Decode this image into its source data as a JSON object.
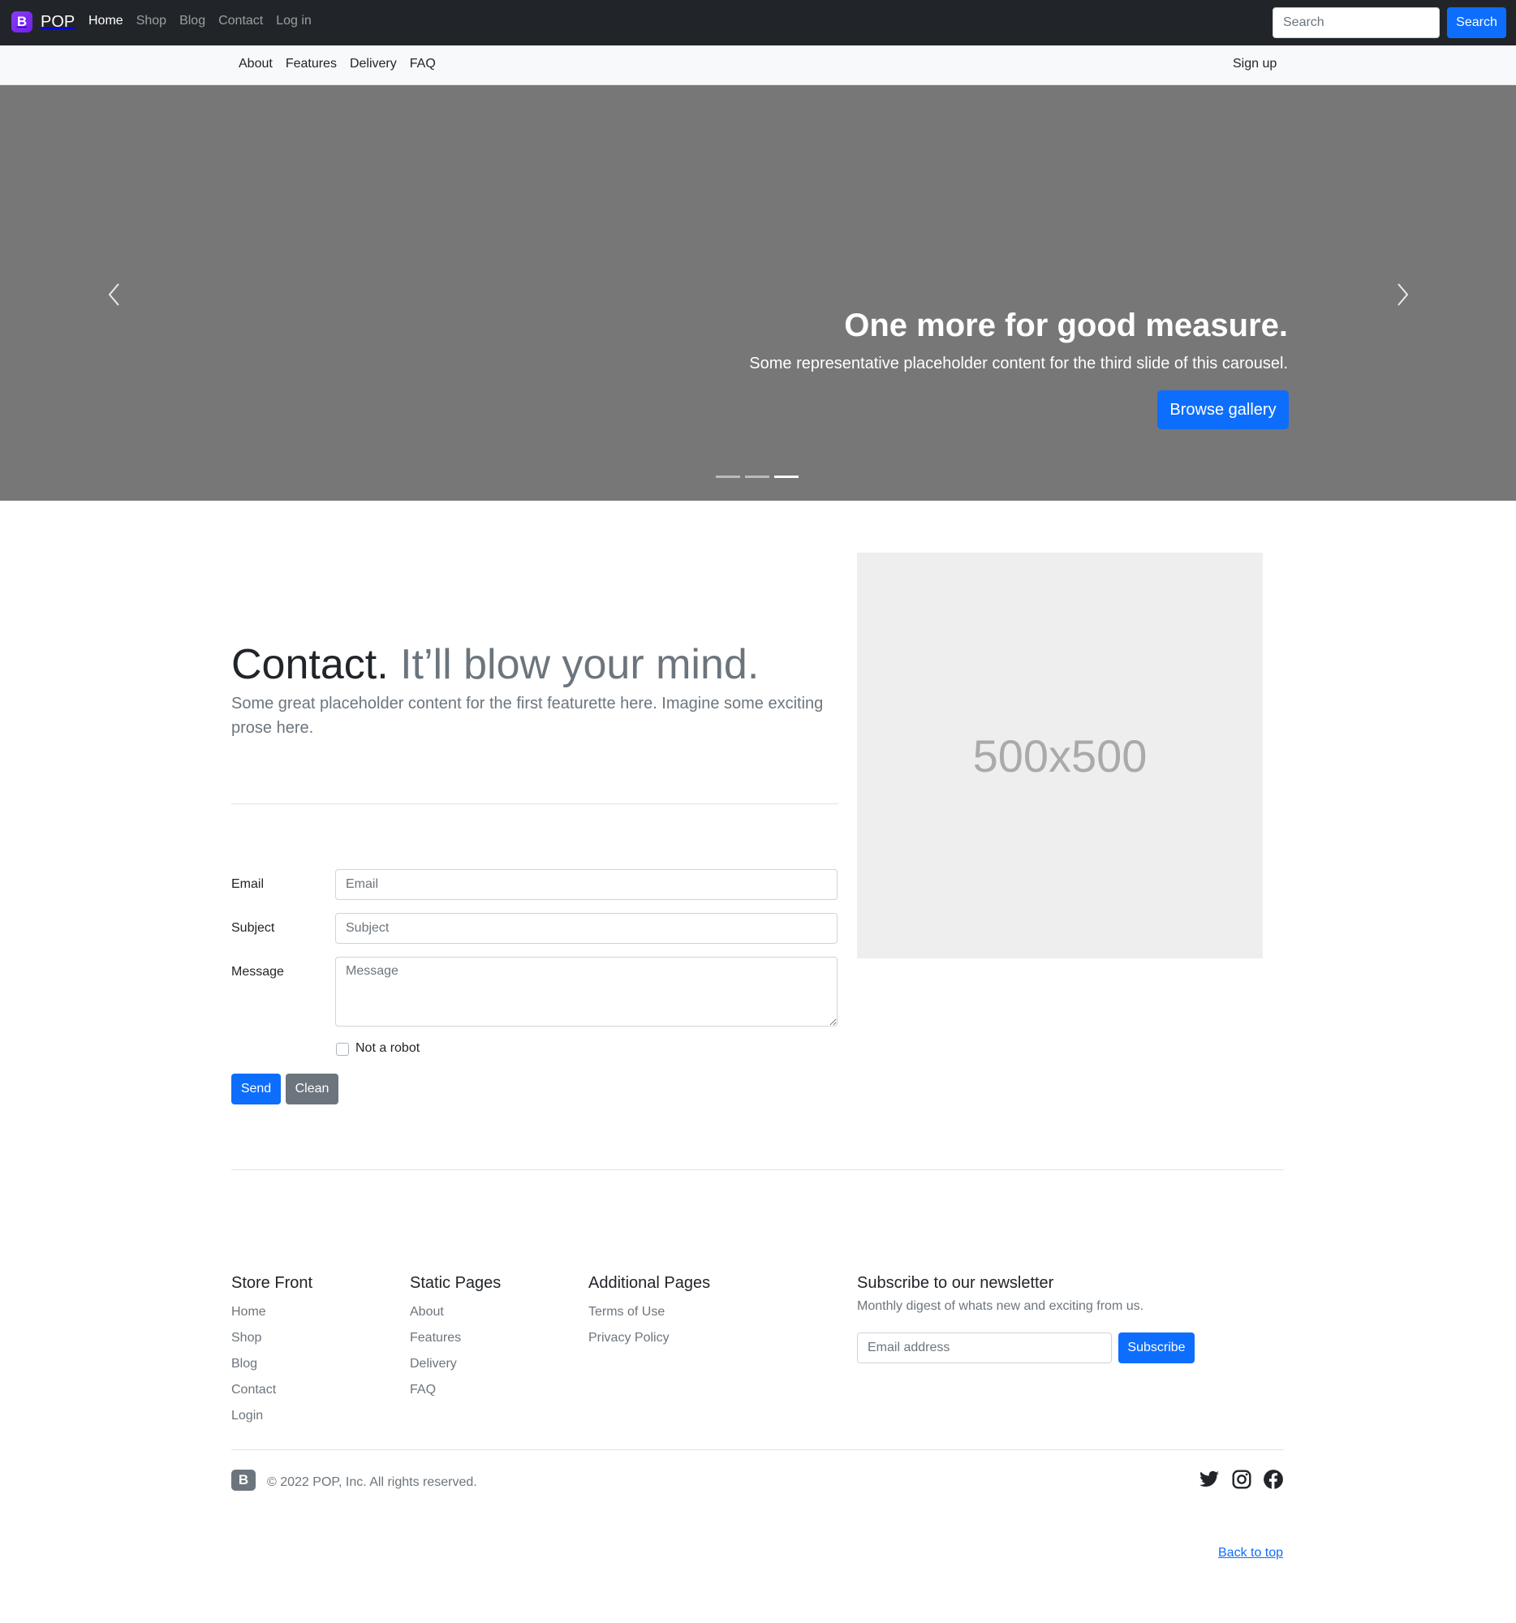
{
  "topnav": {
    "brand_logo": "B",
    "brand_name": "POP",
    "links": [
      "Home",
      "Shop",
      "Blog",
      "Contact",
      "Log in"
    ],
    "search_placeholder": "Search",
    "search_button": "Search"
  },
  "subnav": {
    "links": [
      "About",
      "Features",
      "Delivery",
      "FAQ"
    ],
    "signup": "Sign up"
  },
  "carousel": {
    "title": "One more for good measure.",
    "text": "Some representative placeholder content for the third slide of this carousel.",
    "button": "Browse gallery",
    "active_slide": 3,
    "slide_count": 3
  },
  "featurette": {
    "heading_main": "Contact.",
    "heading_muted": "It’ll blow your mind.",
    "lead": "Some great placeholder content for the first featurette here. Imagine some exciting prose here.",
    "image_label": "500x500"
  },
  "form": {
    "email_label": "Email",
    "email_placeholder": "Email",
    "subject_label": "Subject",
    "subject_placeholder": "Subject",
    "message_label": "Message",
    "message_placeholder": "Message",
    "checkbox_label": "Not a robot",
    "send_button": "Send",
    "clean_button": "Clean"
  },
  "footer": {
    "columns": [
      {
        "title": "Store Front",
        "links": [
          "Home",
          "Shop",
          "Blog",
          "Contact",
          "Login"
        ]
      },
      {
        "title": "Static Pages",
        "links": [
          "About",
          "Features",
          "Delivery",
          "FAQ"
        ]
      },
      {
        "title": "Additional Pages",
        "links": [
          "Terms of Use",
          "Privacy Policy"
        ]
      }
    ],
    "newsletter": {
      "title": "Subscribe to our newsletter",
      "text": "Monthly digest of whats new and exciting from us.",
      "placeholder": "Email address",
      "button": "Subscribe"
    },
    "logo": "B",
    "copyright": "© 2022 POP, Inc. All rights reserved.",
    "social_icons": [
      "twitter-icon",
      "instagram-icon",
      "facebook-icon"
    ],
    "back_to_top": "Back to top"
  },
  "colors": {
    "primary": "#0d6efd",
    "dark_nav": "#212529",
    "secondary": "#6c757d",
    "carousel_bg": "#777777",
    "placeholder_bg": "#eeeeee"
  }
}
